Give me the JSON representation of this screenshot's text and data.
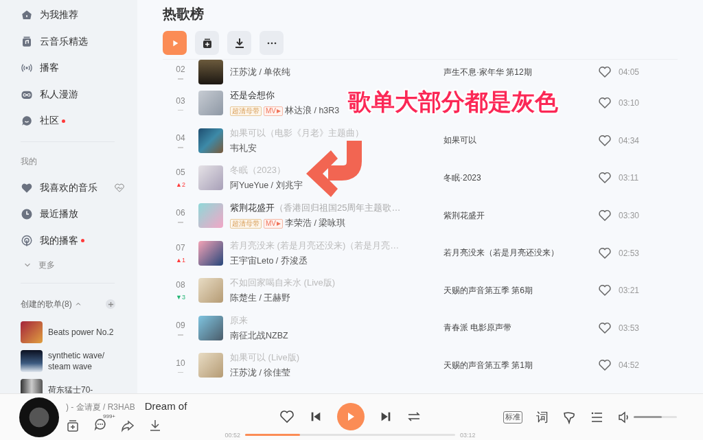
{
  "sidebar": {
    "nav": [
      {
        "label": "为我推荐",
        "dot": false
      },
      {
        "label": "云音乐精选",
        "dot": false
      },
      {
        "label": "播客",
        "dot": false
      },
      {
        "label": "私人漫游",
        "dot": false
      },
      {
        "label": "社区",
        "dot": true
      }
    ],
    "mine_heading": "我的",
    "mine": [
      {
        "label": "我喜欢的音乐",
        "dot": false
      },
      {
        "label": "最近播放",
        "dot": false
      },
      {
        "label": "我的播客",
        "dot": true
      }
    ],
    "more": "更多",
    "playlists_heading": "创建的歌单(8)",
    "playlists": [
      {
        "name": "Beats power No.2"
      },
      {
        "name": "synthetic wave/ steam wave"
      },
      {
        "name": "荷东猛士70-"
      }
    ]
  },
  "header": {
    "title": "热歌榜"
  },
  "songs": [
    {
      "rank": "02",
      "artists": "汪苏泷 / 单依纯",
      "album": "声生不息·家年华 第12期",
      "duration": "04:05",
      "change": {
        "kind": "same"
      }
    },
    {
      "rank": "03",
      "title": "还是会想你",
      "available": true,
      "badges": [
        {
          "kind": "hq",
          "text": "超清母带"
        },
        {
          "kind": "mv",
          "text": "MV"
        }
      ],
      "artists": "林达浪 / h3R3",
      "duration": "03:10",
      "change": {
        "kind": "same"
      }
    },
    {
      "rank": "04",
      "title": "如果可以（电影《月老》主题曲）",
      "available": false,
      "artists": "韦礼安",
      "album": "如果可以",
      "duration": "04:34",
      "change": {
        "kind": "same"
      }
    },
    {
      "rank": "05",
      "title": "冬眠（2023）",
      "available": false,
      "artists": "阿YueYue / 刘兆宇",
      "album": "冬眠·2023",
      "duration": "03:11",
      "change": {
        "kind": "up",
        "text": "▲2"
      }
    },
    {
      "rank": "06",
      "title": "紫荆花盛开",
      "subtitle": "（香港回归祖国25周年主题歌…",
      "available": true,
      "badges": [
        {
          "kind": "hq",
          "text": "超清母带"
        },
        {
          "kind": "mv",
          "text": "MV"
        }
      ],
      "artists": "李荣浩 / 梁咏琪",
      "album": "紫荆花盛开",
      "duration": "03:30",
      "change": {
        "kind": "same"
      }
    },
    {
      "rank": "07",
      "title": "若月亮没来 (若是月亮还没来)（若是月亮…",
      "available": false,
      "artists": "王宇宙Leto / 乔浚丞",
      "album": "若月亮没来（若是月亮还没来）",
      "duration": "02:53",
      "change": {
        "kind": "up",
        "text": "▲1"
      }
    },
    {
      "rank": "08",
      "title": "不如回家喝自来水 (Live版)",
      "available": false,
      "artists": "陈楚生 / 王赫野",
      "album": "天赐的声音第五季 第6期",
      "duration": "03:21",
      "change": {
        "kind": "down",
        "text": "▼3"
      }
    },
    {
      "rank": "09",
      "title": "原来",
      "available": false,
      "artists": "南征北战NZBZ",
      "album": "青春派 电影原声带",
      "duration": "03:53",
      "change": {
        "kind": "same"
      }
    },
    {
      "rank": "10",
      "title": "如果可以 (Live版)",
      "available": false,
      "artists": "汪苏泷 / 徐佳莹",
      "album": "天赐的声音第五季 第1期",
      "duration": "04:52",
      "change": {
        "kind": "same"
      }
    }
  ],
  "annotation": {
    "text": "歌单大部分都是灰色"
  },
  "player": {
    "artist_line": ") - 金请夏 / R3HAB",
    "title": "Dream of",
    "comment_count": "999+",
    "elapsed": "00:52",
    "progress": {
      "level": 0.26
    },
    "total": "03:12",
    "quality": "标准",
    "lyrics": "词",
    "volume": {
      "level": 0.65
    }
  }
}
